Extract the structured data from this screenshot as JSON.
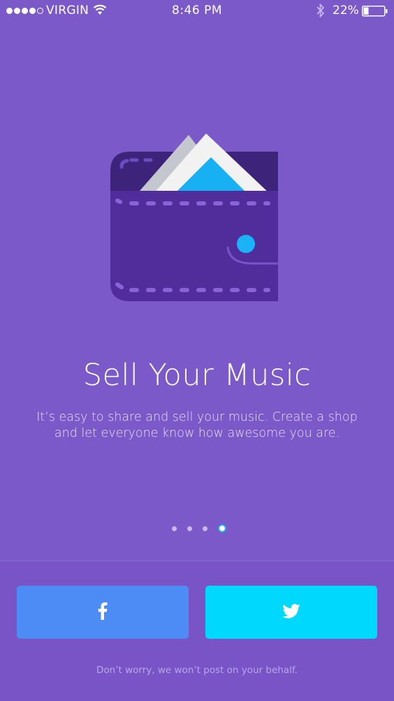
{
  "status_bar": {
    "carrier": "VIRGIN",
    "time": "8:46 PM",
    "battery": "22%",
    "signal_strength": "4 of 5",
    "icons": [
      "wifi-icon",
      "bluetooth-icon",
      "battery-icon"
    ]
  },
  "onboarding": {
    "illustration": "wallet-with-photos-illustration",
    "title": "Sell Your Music",
    "description": "It’s easy to share and sell your music. Create a shop and let everyone know how awesome you are.",
    "pager": {
      "total": 4,
      "current": 4
    }
  },
  "auth": {
    "facebook_icon": "facebook-icon",
    "twitter_icon": "twitter-icon",
    "disclaimer": "Don’t worry, we won’t post on your behalf."
  },
  "colors": {
    "background": "#7b59c9",
    "facebook": "#4d8bf5",
    "twitter": "#00d8fe",
    "accent": "#1fa6f2"
  }
}
